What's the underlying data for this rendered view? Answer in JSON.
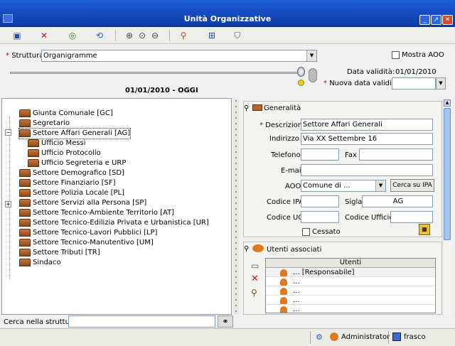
{
  "window": {
    "title": "Unità Organizzative"
  },
  "toolbar": {
    "icons": [
      "save-icon",
      "delete-icon",
      "refresh-icon",
      "sync-icon",
      "zoom-in-icon",
      "zoom-icon",
      "zoom-out-icon",
      "users-search-icon",
      "org-chart-icon",
      "shield-icon"
    ]
  },
  "struttura": {
    "label": "Struttura",
    "value": "Organigramme"
  },
  "mostra_aoo": {
    "label": "Mostra AOO"
  },
  "validity": {
    "data_label": "Data validità:",
    "data_value": "01/01/2010",
    "nuova_label": "Nuova data validità",
    "current": "01/01/2010 - OGGI"
  },
  "tree": {
    "nodes": [
      {
        "label": "Giunta Comunale [GC]"
      },
      {
        "label": "Segretario"
      },
      {
        "label": "Settore Affari Generali [AG]"
      },
      {
        "label": "Ufficio Messi"
      },
      {
        "label": "Ufficio Protocollo"
      },
      {
        "label": "Ufficio Segreteria e URP"
      },
      {
        "label": "Settore Demografico [SD]"
      },
      {
        "label": "Settore Finanziario [SF]"
      },
      {
        "label": "Settore Polizia Locale [PL]"
      },
      {
        "label": "Settore Servizi alla Persona [SP]"
      },
      {
        "label": "Settore Tecnico-Ambiente Territorio [AT]"
      },
      {
        "label": "Settore Tecnico-Edilizia Privata e Urbanistica [UR]"
      },
      {
        "label": "Settore Tecnico-Lavori Pubblici [LP]"
      },
      {
        "label": "Settore Tecnico-Manutentivo [UM]"
      },
      {
        "label": "Settore Tributi [TR]"
      },
      {
        "label": "Sindaco"
      }
    ]
  },
  "search": {
    "label": "Cerca nella struttura"
  },
  "generalita": {
    "title": "Generalità",
    "descrizione_label": "Descrizione",
    "descrizione": "Settore Affari Generali",
    "indirizzo_label": "Indirizzo",
    "indirizzo": "Via XX Settembre 16",
    "telefono_label": "Telefono",
    "telefono": "",
    "fax_label": "Fax",
    "fax": "",
    "email_label": "E-mail",
    "email": "",
    "aoo_label": "AOO",
    "aoo": "Comune di ...",
    "cerca_ipa": "Cerca su IPA",
    "codice_ipa_label": "Codice IPA",
    "codice_ipa": "",
    "sigla_label": "Sigla",
    "sigla": "AG",
    "codice_uo_label": "Codice UO",
    "codice_uo": "",
    "codice_ufficio_label": "Codice Ufficio",
    "codice_ufficio": "",
    "cessato_label": "Cessato"
  },
  "utenti": {
    "title": "Utenti associati",
    "column": "Utenti",
    "rows": [
      {
        "name": "... [Responsabile]"
      },
      {
        "name": "..."
      },
      {
        "name": "..."
      },
      {
        "name": "..."
      },
      {
        "name": "..."
      }
    ]
  },
  "status": {
    "user": "Administrator",
    "other": "frasco"
  }
}
